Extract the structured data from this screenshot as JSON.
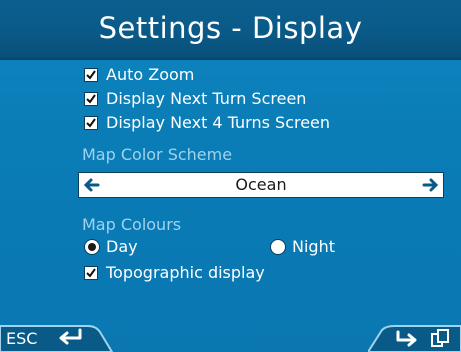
{
  "header": {
    "title": "Settings - Display"
  },
  "options": [
    {
      "label": "Auto Zoom",
      "checked": true
    },
    {
      "label": "Display Next Turn Screen",
      "checked": true
    },
    {
      "label": "Display Next 4 Turns Screen",
      "checked": true
    }
  ],
  "map_color_scheme": {
    "label": "Map Color Scheme",
    "value": "Ocean"
  },
  "map_colours": {
    "label": "Map Colours",
    "day_label": "Day",
    "night_label": "Night",
    "selected": "Day",
    "topographic_label": "Topographic display",
    "topographic_checked": true
  },
  "footer": {
    "esc_label": "ESC"
  },
  "colors": {
    "background": "#0a7cb6",
    "header": "#0a5a88",
    "section_label": "#9fd3ee"
  },
  "icons": [
    "checkbox-checked-icon",
    "arrow-left-icon",
    "arrow-right-icon",
    "radio-selected-icon",
    "radio-unselected-icon",
    "back-arrow-icon",
    "next-arrow-icon",
    "pages-icon"
  ]
}
